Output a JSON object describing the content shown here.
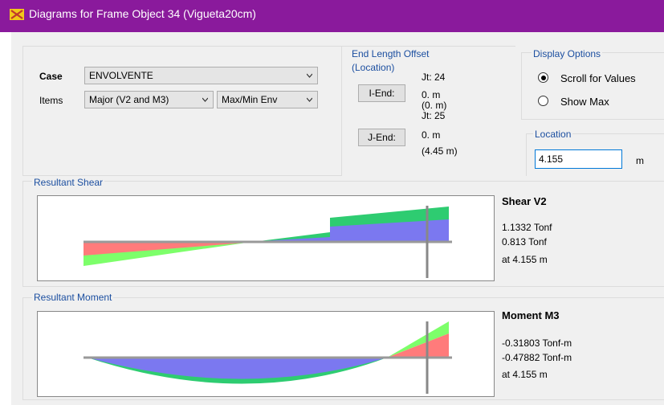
{
  "window": {
    "title": "Diagrams for Frame Object 34  (Vigueta20cm)",
    "icon": "app-icon",
    "title_bar_color": "#8a1a9c"
  },
  "case_group": {
    "case_label": "Case",
    "case_value": "ENVOLVENTE",
    "items_label": "Items",
    "items_value": "Major (V2 and M3)",
    "envelope_value": "Max/Min Env"
  },
  "end_offset": {
    "legend": "End Length Offset",
    "location_label": "(Location)",
    "i_end_button": "I-End:",
    "i_joint": "Jt:  24",
    "i_offset": "0. m",
    "i_location": "(0. m)",
    "j_end_button": "J-End:",
    "j_joint": "Jt:  25",
    "j_offset": "0. m",
    "j_location": "(4.45 m)"
  },
  "display_options": {
    "legend": "Display Options",
    "scroll_label": "Scroll for Values",
    "show_max_label": "Show Max",
    "selected": "scroll"
  },
  "location": {
    "legend": "Location",
    "value": "4.155",
    "unit": "m"
  },
  "shear": {
    "legend": "Resultant Shear",
    "title": "Shear V2",
    "value_max": "1.1332 Tonf",
    "value_min": "0.813 Tonf",
    "at": "at 4.155 m"
  },
  "moment": {
    "legend": "Resultant Moment",
    "title": "Moment M3",
    "value_max": "-0.31803 Tonf-m",
    "value_min": "-0.47882 Tonf-m",
    "at": "at 4.155 m"
  },
  "colors": {
    "positive": "#2ecc71",
    "negative": "#ff6f6f",
    "overlap": "#7b78f0",
    "baseline": "#999999"
  }
}
